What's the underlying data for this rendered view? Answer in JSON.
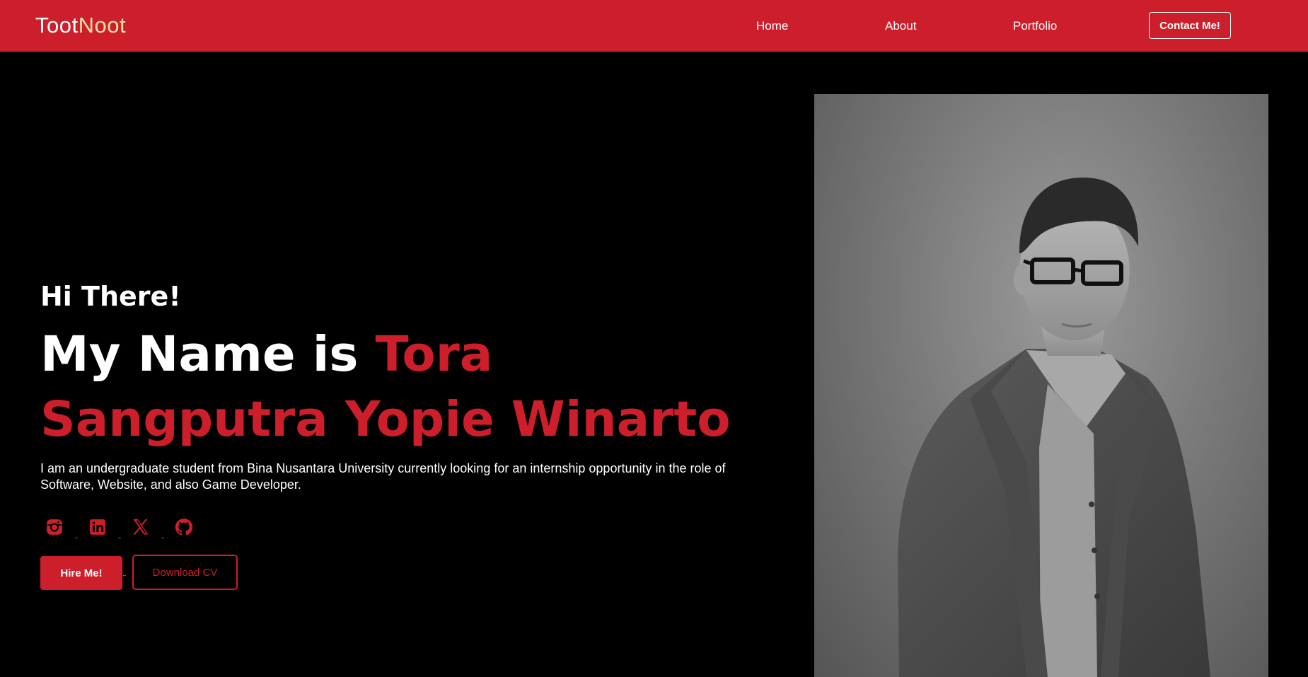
{
  "navbar": {
    "logo_part1": "Toot",
    "logo_part2": "Noot",
    "links": [
      {
        "label": "Home"
      },
      {
        "label": "About"
      },
      {
        "label": "Portfolio"
      }
    ],
    "contact_label": "Contact Me!"
  },
  "hero": {
    "greeting": "Hi There!",
    "headline_prefix": "My Name is ",
    "name": "Tora Sangputra Yopie Winarto",
    "bio": "I am an undergraduate student from Bina Nusantara University currently looking for an internship opportunity in the role of Software, Website, and also Game Developer.",
    "socials": [
      {
        "icon": "instagram-icon"
      },
      {
        "icon": "linkedin-icon"
      },
      {
        "icon": "x-twitter-icon"
      },
      {
        "icon": "github-icon"
      }
    ],
    "hire_label": "Hire Me!",
    "cv_label": "Download CV"
  },
  "portrait": {
    "description_icon": "profile-photo"
  },
  "colors": {
    "accent": "#cd1f2b",
    "background": "#000000",
    "text": "#ffffff",
    "logo_accent": "#f7e0a3"
  }
}
